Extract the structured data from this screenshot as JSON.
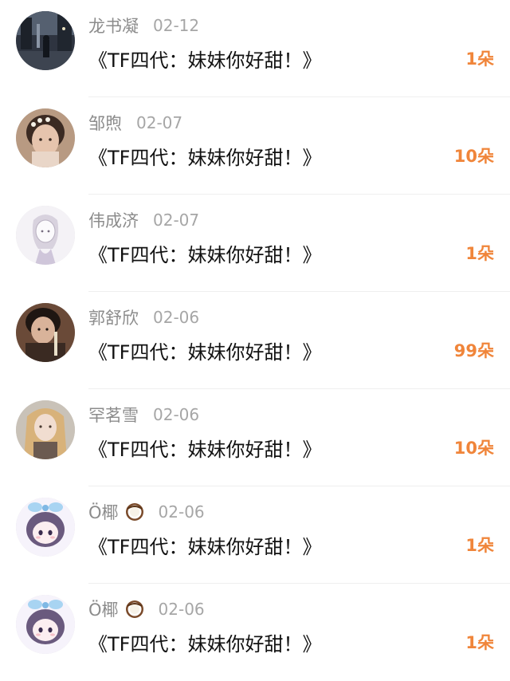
{
  "gifts": [
    {
      "name": "龙书凝",
      "date": "02-12",
      "title": "《TF四代：妹妹你好甜！》",
      "count": "1朵",
      "avatar": "night-street-photo"
    },
    {
      "name": "邹煦",
      "date": "02-07",
      "title": "《TF四代：妹妹你好甜！》",
      "count": "10朵",
      "avatar": "girl-selfie-photo"
    },
    {
      "name": "伟成济",
      "date": "02-07",
      "title": "《TF四代：妹妹你好甜！》",
      "count": "1朵",
      "avatar": "sketch-girl-drawing"
    },
    {
      "name": "郭舒欣",
      "date": "02-06",
      "title": "《TF四代：妹妹你好甜！》",
      "count": "99朵",
      "avatar": "girl-eating-photo"
    },
    {
      "name": "罕茗雪",
      "date": "02-06",
      "title": "《TF四代：妹妹你好甜！》",
      "count": "10朵",
      "avatar": "blonde-doll-photo"
    },
    {
      "name": "Ö椰",
      "emoji": "coconut-icon",
      "date": "02-06",
      "title": "《TF四代：妹妹你好甜！》",
      "count": "1朵",
      "avatar": "anime-girl-drawing"
    },
    {
      "name": "Ö椰",
      "emoji": "coconut-icon",
      "date": "02-06",
      "title": "《TF四代：妹妹你好甜！》",
      "count": "1朵",
      "avatar": "anime-girl-drawing"
    }
  ]
}
